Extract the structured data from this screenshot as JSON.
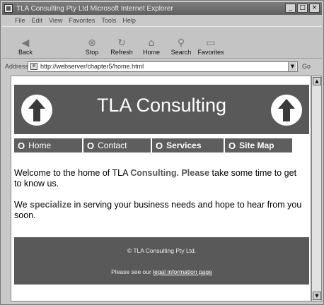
{
  "window": {
    "title": "TLA Consulting Pty Ltd    Microsoft Internet Explorer",
    "controls": {
      "minimize": "_",
      "maximize": "□",
      "close": "×"
    }
  },
  "menu": {
    "items": [
      "File",
      "Edit",
      "View",
      "Favorites",
      "Tools",
      "Help"
    ]
  },
  "toolbar": {
    "back_label": "Back",
    "stop_label": "Stop",
    "refresh_label": "Refresh",
    "home_label": "Home",
    "search_label": "Search",
    "favorites_label": "Favorites"
  },
  "address": {
    "label": "Address",
    "url": "http://webserver/chapter5/home.html",
    "go_label": "Go"
  },
  "page": {
    "banner_title": "TLA Consulting",
    "nav": [
      {
        "icon": "O",
        "label": "Home"
      },
      {
        "icon": "O",
        "label": "Contact"
      },
      {
        "icon": "O",
        "label": "Services"
      },
      {
        "icon": "O",
        "label": "Site Map"
      }
    ],
    "para1": {
      "before": "Welcome to the home of TLA ",
      "hl1": "Consulting.",
      "mid": " ",
      "hl2": "Please",
      "after": " take some time to get to know us."
    },
    "para2": {
      "before": "We ",
      "hl": "specialize",
      "after": " in serving your business needs and hope to hear from you soon."
    },
    "footer": {
      "copyright": "© TLA Consulting Pty Ltd.",
      "line2_before": "Please see our ",
      "line2_link": "legal information page"
    }
  },
  "colors": {
    "banner_bg": "#595959",
    "nav_bg": "#5e5e5e",
    "highlight": "#555555"
  }
}
